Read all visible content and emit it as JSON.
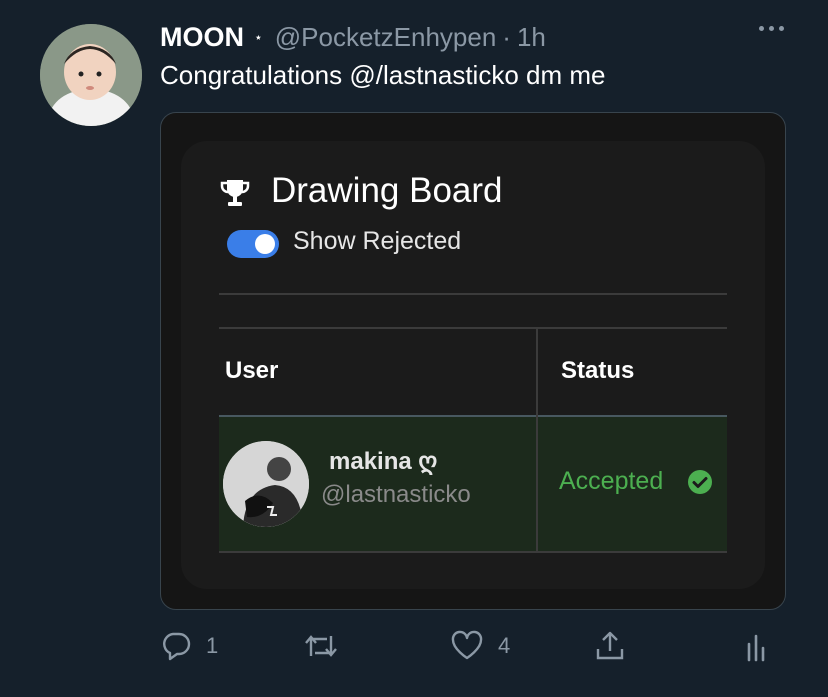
{
  "tweet": {
    "author_name": "MOON",
    "author_badge": "⋆",
    "handle": "@PocketzEnhypen",
    "separator": "·",
    "time": "1h",
    "text": "Congratulations @/lastnasticko dm me"
  },
  "card": {
    "title": "Drawing Board",
    "toggle": {
      "label": "Show Rejected",
      "on": true,
      "color": "#3a7ee8"
    },
    "table": {
      "headers": [
        "User",
        "Status"
      ],
      "rows": [
        {
          "name": "makina ღ",
          "handle": "@lastnasticko",
          "status": "Accepted",
          "status_color": "#4caf50"
        }
      ]
    }
  },
  "actions": {
    "reply_count": "1",
    "retweet_count": "",
    "like_count": "4"
  },
  "colors": {
    "background": "#15202b",
    "muted": "#8b98a5"
  }
}
